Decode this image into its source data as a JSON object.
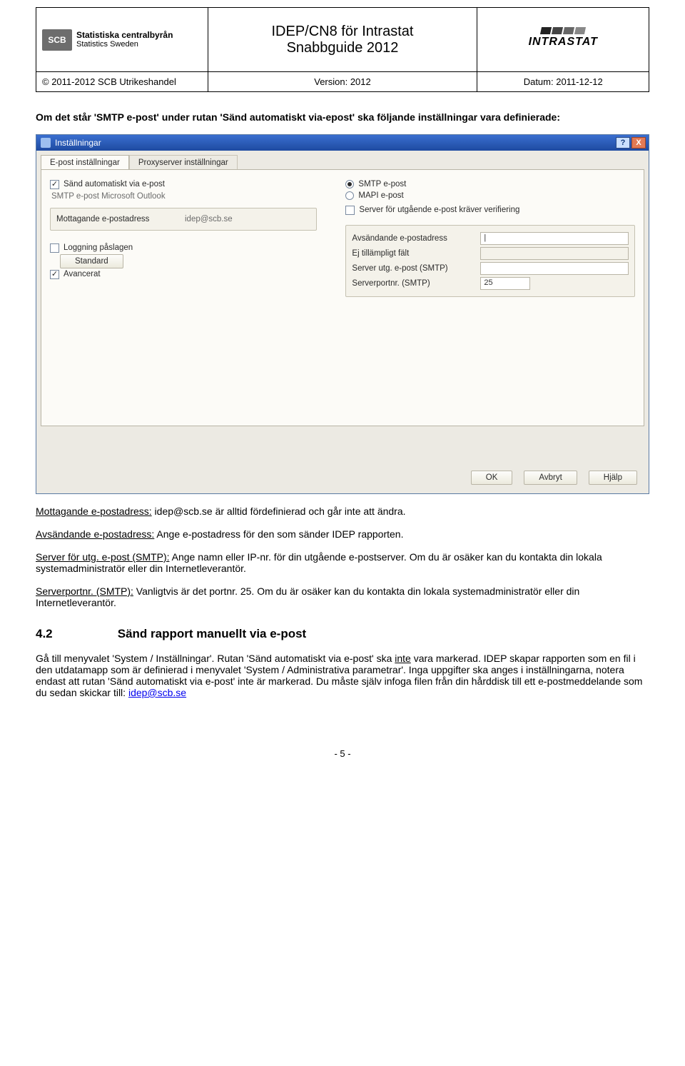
{
  "header": {
    "scb_main": "Statistiska centralbyrån",
    "scb_sub": "Statistics Sweden",
    "scb_badge": "SCB",
    "title_line1": "IDEP/CN8 för Intrastat",
    "title_line2": "Snabbguide 2012",
    "brand": "INTRASTAT",
    "copyright": "© 2011-2012 SCB Utrikeshandel",
    "version_label": "Version: 2012",
    "date_label": "Datum: 2011-12-12"
  },
  "intro": {
    "line1": "Om det står 'SMTP e-post' under rutan 'Sänd automatiskt via-epost' ska följande inställningar vara definierade:"
  },
  "screenshot": {
    "title": "Inställningar",
    "help_btn": "?",
    "close_btn": "X",
    "tab_active": "E-post inställningar",
    "tab_inactive": "Proxyserver inställningar",
    "chk_autosend": "Sänd automatiskt via e-post",
    "smtp_line": "SMTP e-post Microsoft Outlook",
    "recv_group_label": "Mottagande e-postadress",
    "recv_value": "idep@scb.se",
    "chk_logging": "Loggning påslagen",
    "btn_standard": "Standard",
    "chk_advanced": "Avancerat",
    "rad_smtp": "SMTP e-post",
    "rad_mapi": "MAPI e-post",
    "chk_server_verify": "Server för utgående e-post kräver verifiering",
    "fld_sender": "Avsändande e-postadress",
    "fld_na": "Ej tillämpligt fält",
    "fld_smtp": "Server utg. e-post (SMTP)",
    "fld_port": "Serverportnr. (SMTP)",
    "port_value": "25",
    "btn_ok": "OK",
    "btn_cancel": "Avbryt",
    "btn_help": "Hjälp"
  },
  "paragraphs": {
    "p1_a": "Mottagande e-postadress:",
    "p1_b": " idep@scb.se är alltid fördefinierad och går inte att ändra.",
    "p2_a": "Avsändande e-postadress:",
    "p2_b": " Ange e-postadress för den som sänder IDEP rapporten.",
    "p3_a": "Server för utg. e-post (SMTP):",
    "p3_b": " Ange namn eller IP-nr. för din utgående e-postserver. Om du är osäker kan du kontakta din lokala systemadministratör eller din Internetleverantör.",
    "p4_a": "Serverportnr. (SMTP):",
    "p4_b": " Vanligtvis är det portnr. 25. Om du är osäker kan du kontakta din lokala systemadministratör eller din Internetleverantör."
  },
  "section": {
    "num": "4.2",
    "title": "Sänd rapport manuellt via e-post",
    "body_a": "Gå till menyvalet 'System / Inställningar'. Rutan 'Sänd automatiskt via e-post' ska ",
    "body_inte": "inte",
    "body_b": " vara markerad. IDEP skapar rapporten som en fil i den utdatamapp som är definierad i menyvalet 'System / Administrativa parametrar'. Inga uppgifter ska anges i inställningarna, notera endast att rutan 'Sänd automatiskt via e-post' inte är markerad. Du måste själv infoga filen från din hårddisk till ett e-postmeddelande som du sedan skickar till: ",
    "email": "idep@scb.se"
  },
  "page_number": "- 5 -"
}
